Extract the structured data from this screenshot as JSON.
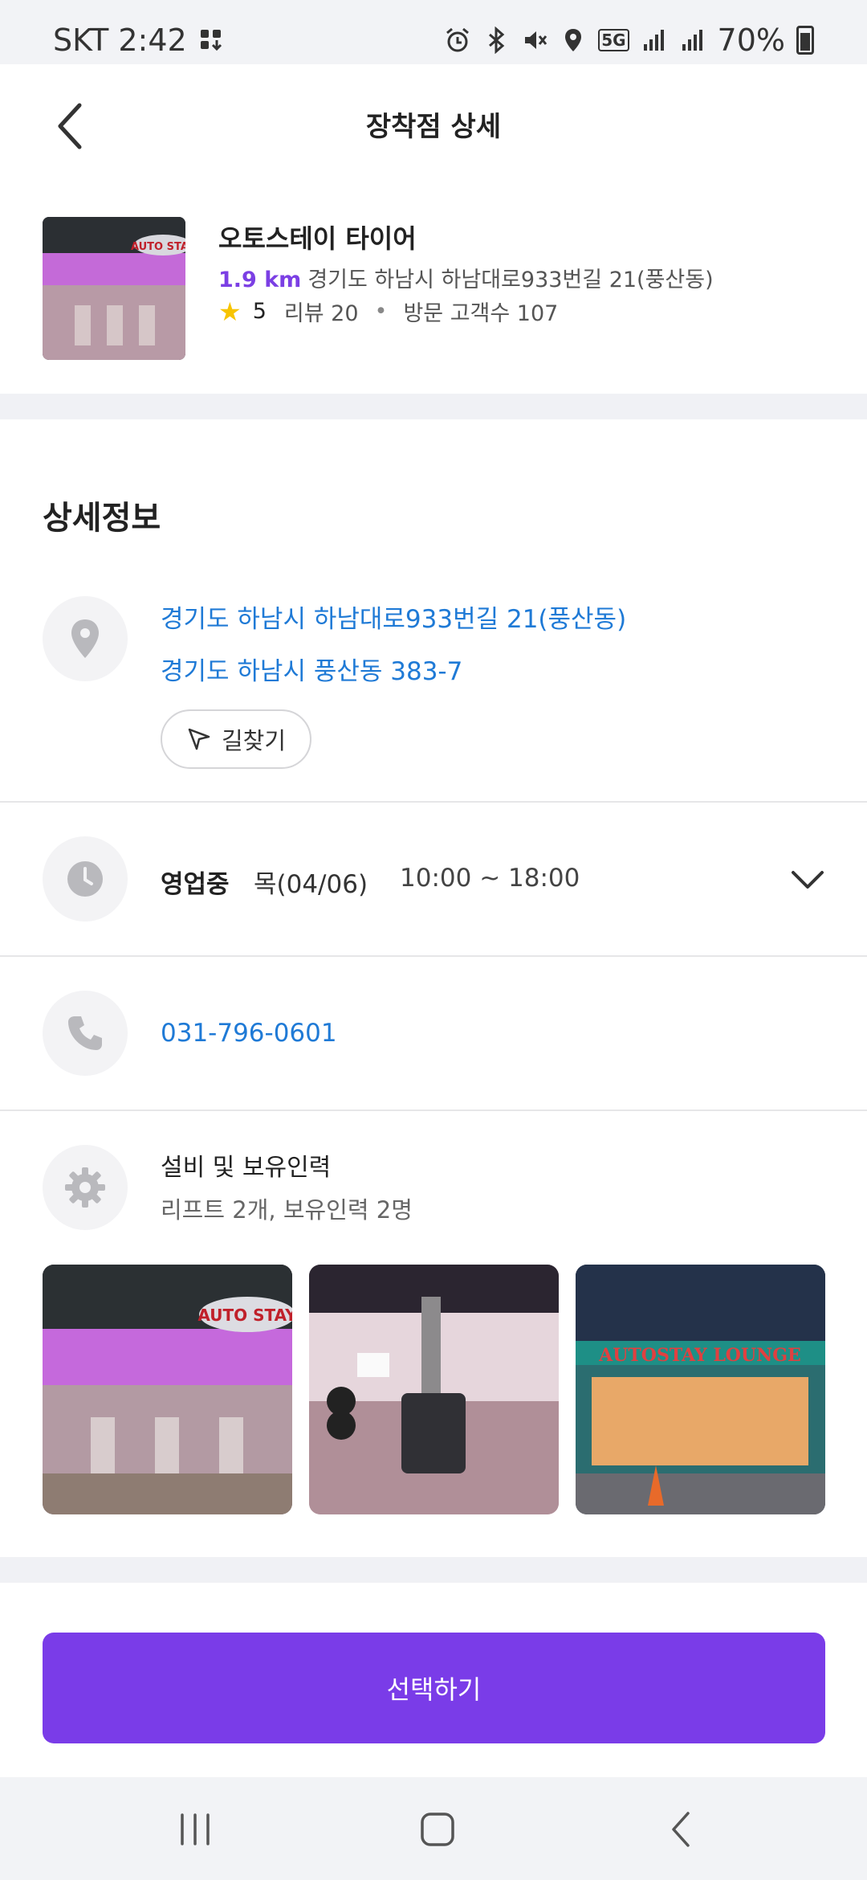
{
  "status_bar": {
    "carrier_time": "SKT 2:42",
    "network": "5G",
    "battery": "70%"
  },
  "header": {
    "title": "장착점 상세"
  },
  "shop": {
    "name": "오토스테이 타이어",
    "distance": "1.9 km",
    "address": "경기도 하남시 하남대로933번길 21(풍산동)",
    "rating": "5",
    "reviews": "리뷰 20",
    "visitors": "방문 고객수 107"
  },
  "detail": {
    "section_title": "상세정보",
    "road_address": "경기도 하남시 하남대로933번길 21(풍산동)",
    "lot_address": "경기도 하남시 풍산동 383-7",
    "route_button": "길찾기",
    "hours": {
      "status": "영업중",
      "day": "목(04/06)",
      "time": "10:00 ~ 18:00"
    },
    "phone": "031-796-0601",
    "equipment": {
      "title": "설비 및 보유인력",
      "value": "리프트 2개, 보유인력 2명"
    },
    "photo_signs": [
      "AUTO STAY",
      "AUTOSTAY LOUNGE"
    ]
  },
  "select_button": "선택하기",
  "colors": {
    "accent": "#7a3ce8",
    "link": "#1f7ad6",
    "distance": "#7b3fe4",
    "star": "#f7c400"
  }
}
